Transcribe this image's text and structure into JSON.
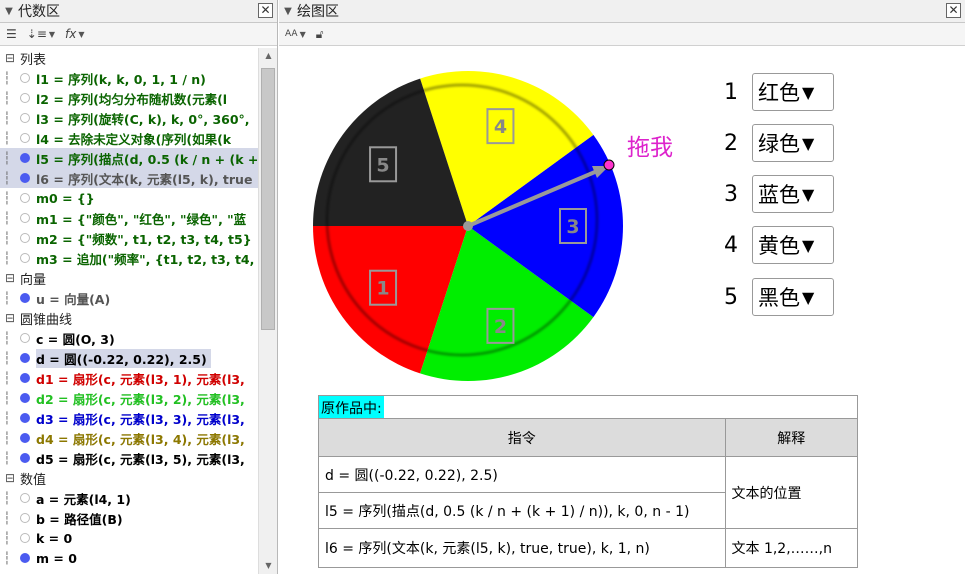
{
  "algebra": {
    "title": "代数区",
    "toolbar": {
      "fx": "fx"
    },
    "categories": {
      "list": "列表",
      "vector": "向量",
      "conic": "圆锥曲线",
      "number": "数值"
    },
    "items": {
      "l1": "l1 = 序列(k, k, 0, 1, 1 / n)",
      "l2": "l2 = 序列(均匀分布随机数(元素(l",
      "l3": "l3 = 序列(旋转(C, k), k, 0°, 360°,",
      "l4": "l4 = 去除未定义对象(序列(如果(k",
      "l5": "l5 = 序列(描点(d, 0.5 (k / n + (k +",
      "l6": "l6 = 序列(文本(k, 元素(l5, k), true",
      "m0": "m0 = {}",
      "m1": "m1 = {\"颜色\", \"红色\", \"绿色\", \"蓝",
      "m2": "m2 = {\"频数\", t1, t2, t3, t4, t5}",
      "m3": "m3 = 追加(\"频率\", {t1, t2, t3, t4, t",
      "u": "u = 向量(A)",
      "c": "c = 圆(O, 3)",
      "d": "d = 圆((-0.22, 0.22), 2.5)",
      "d1": "d1 = 扇形(c, 元素(l3, 1), 元素(l3,",
      "d2": "d2 = 扇形(c, 元素(l3, 2), 元素(l3,",
      "d3": "d3 = 扇形(c, 元素(l3, 3), 元素(l3,",
      "d4": "d4 = 扇形(c, 元素(l3, 4), 元素(l3,",
      "d5": "d5 = 扇形(c, 元素(l3, 5), 元素(l3,",
      "a": "a = 元素(l4, 1)",
      "b": "b = 路径值(B)",
      "k": "k = 0",
      "m": "m = 0"
    }
  },
  "graphics": {
    "title": "绘图区",
    "toolbar": {
      "aa": "AA"
    },
    "drag_label": "拖我",
    "sector_labels": [
      "1",
      "2",
      "3",
      "4",
      "5"
    ],
    "sector_colors": [
      "#ff0000",
      "#00ee00",
      "#0000ff",
      "#ffff00",
      "#222222"
    ],
    "color_rows": [
      {
        "num": "1",
        "value": "红色"
      },
      {
        "num": "2",
        "value": "绿色"
      },
      {
        "num": "3",
        "value": "蓝色"
      },
      {
        "num": "4",
        "value": "黄色"
      },
      {
        "num": "5",
        "value": "黑色"
      }
    ],
    "table": {
      "caption": "原作品中:",
      "headers": [
        "指令",
        "解释"
      ],
      "rows": [
        {
          "cmd": "d = 圆((-0.22, 0.22), 2.5)",
          "explain": ""
        },
        {
          "cmd": "l5 = 序列(描点(d, 0.5 (k / n + (k + 1) / n)), k, 0, n - 1)",
          "explain": "文本的位置"
        },
        {
          "cmd": "l6 = 序列(文本(k, 元素(l5, k), true, true), k, 1, n)",
          "explain": "文本 1,2,……,n"
        }
      ]
    }
  }
}
